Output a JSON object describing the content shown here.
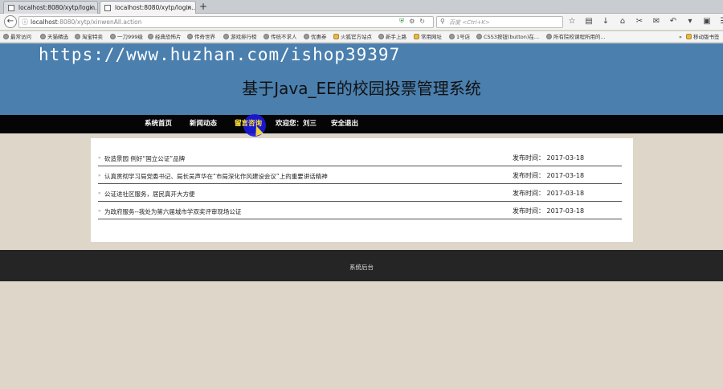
{
  "browser": {
    "tabs": [
      {
        "title": "localhost:8080/xytp/login..."
      },
      {
        "title": "localhost:8080/xytp/login..."
      }
    ],
    "new_tab_symbol": "+",
    "close_symbol": "×",
    "url_host": "localhost",
    "url_rest": ":8080/xytp/xinwenAll.action",
    "search_placeholder": "百度 <Ctrl+K>",
    "bookmarks": [
      "最常访问",
      "天猫精选",
      "淘宝特卖",
      "一刀999级",
      "经典恐怖片",
      "传奇世界",
      "游戏排行榜",
      "传统不求人",
      "优惠券",
      "火狐官方站点",
      "新手上路",
      "常用网址",
      "1号店",
      "CSS3按钮(button)在...",
      "所有院校课程所用的..."
    ],
    "bookmarks_more": "»",
    "mobile_bookmarks": "移动版书签"
  },
  "header": {
    "watermark": "https://www.huzhan.com/ishop39397",
    "title": "基于Java_EE的校园投票管理系统"
  },
  "menu": {
    "items": [
      "系统首页",
      "新闻动态",
      "留言咨询",
      "欢迎您：刘三",
      "安全退出"
    ]
  },
  "news": [
    {
      "title": "砍造景园 例好“国立公证”品牌",
      "date_label": "发布时间：",
      "date": "2017-03-18"
    },
    {
      "title": "认真贯彻学习局党委书记、局长吴声华在“市局深化作风建设会议”上的重要讲话精神",
      "date_label": "发布时间：",
      "date": "2017-03-18"
    },
    {
      "title": "公证进社区服务，居民真开大方便",
      "date_label": "发布时间：",
      "date": "2017-03-18"
    },
    {
      "title": "为政府服务--我处为第六届城市学双奖评审现场公证",
      "date_label": "发布时间：",
      "date": "2017-03-18"
    }
  ],
  "footer": {
    "link": "系统后台"
  }
}
